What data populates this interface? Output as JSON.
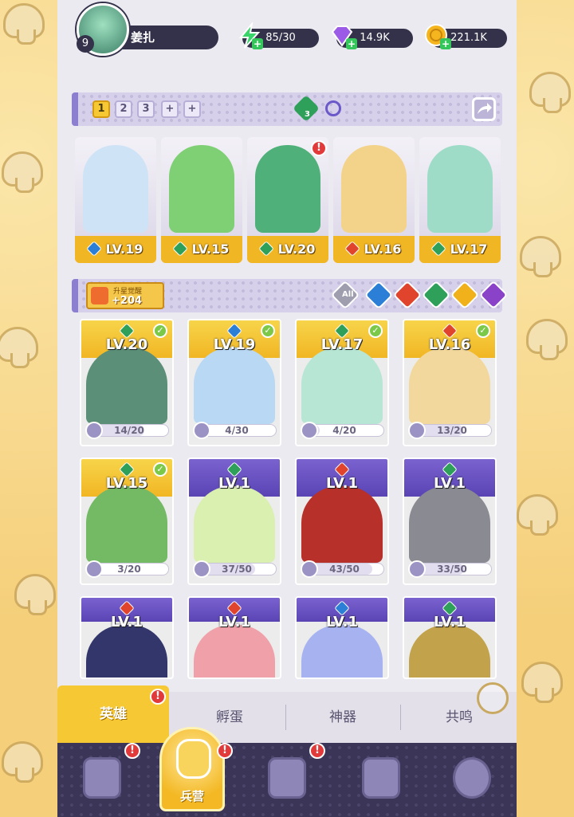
{
  "player": {
    "level": "9",
    "name": "姜扎"
  },
  "resources": {
    "energy": "85/30",
    "gems": "14.9K",
    "gold": "221.1K"
  },
  "team_bar": {
    "slots": [
      "1",
      "2",
      "3",
      "+",
      "+"
    ],
    "active_slot": "1",
    "gem_badge_count": "3"
  },
  "team": [
    {
      "level": "LV.19",
      "element": "water",
      "color": "#2b7fd6",
      "art": "#cfe3f7",
      "alert": false
    },
    {
      "level": "LV.15",
      "element": "nature",
      "color": "#2fa05a",
      "art": "#7fcf74",
      "alert": false
    },
    {
      "level": "LV.20",
      "element": "nature",
      "color": "#2fa05a",
      "art": "#4fb07a",
      "alert": true
    },
    {
      "level": "LV.16",
      "element": "fire",
      "color": "#e0442c",
      "art": "#f3d28a",
      "alert": false
    },
    {
      "level": "LV.17",
      "element": "nature",
      "color": "#2fa05a",
      "art": "#9fdcc8",
      "alert": false
    }
  ],
  "alert_mark": "!",
  "upgrade": {
    "label": "升星觉醒",
    "value": "+204"
  },
  "filters": {
    "all_label": "All",
    "elements": [
      {
        "name": "water",
        "color": "#2b7fd6"
      },
      {
        "name": "fire",
        "color": "#e0442c"
      },
      {
        "name": "nature",
        "color": "#2fa05a"
      },
      {
        "name": "light",
        "color": "#f0b11a"
      },
      {
        "name": "dark",
        "color": "#8a43c8"
      }
    ]
  },
  "heroes": [
    {
      "level": "LV.20",
      "element_color": "#2fa05a",
      "frame": "gold",
      "art": "#5b8f78",
      "shards": "14/20",
      "progress": 0.7,
      "check": true
    },
    {
      "level": "LV.19",
      "element_color": "#2b7fd6",
      "frame": "gold",
      "art": "#b9d8f4",
      "shards": "4/30",
      "progress": 0.13,
      "check": true
    },
    {
      "level": "LV.17",
      "element_color": "#2fa05a",
      "frame": "gold",
      "art": "#b8e6d4",
      "shards": "4/20",
      "progress": 0.2,
      "check": true
    },
    {
      "level": "LV.16",
      "element_color": "#e0442c",
      "frame": "gold",
      "art": "#f2d89c",
      "shards": "13/20",
      "progress": 0.65,
      "check": true
    },
    {
      "level": "LV.15",
      "element_color": "#2fa05a",
      "frame": "gold",
      "art": "#74b964",
      "shards": "3/20",
      "progress": 0.15,
      "check": true
    },
    {
      "level": "LV.1",
      "element_color": "#2fa05a",
      "frame": "purple",
      "art": "#d9f0b0",
      "shards": "37/50",
      "progress": 0.74,
      "check": false
    },
    {
      "level": "LV.1",
      "element_color": "#e0442c",
      "frame": "purple",
      "art": "#b8302a",
      "shards": "43/50",
      "progress": 0.86,
      "check": false
    },
    {
      "level": "LV.1",
      "element_color": "#2fa05a",
      "frame": "purple",
      "art": "#8a8a92",
      "shards": "33/50",
      "progress": 0.66,
      "check": false
    },
    {
      "level": "LV.1",
      "element_color": "#e0442c",
      "frame": "purple",
      "art": "#33366a",
      "shards": "",
      "progress": 0,
      "check": false
    },
    {
      "level": "LV.1",
      "element_color": "#e0442c",
      "frame": "purple",
      "art": "#f0a0a8",
      "shards": "",
      "progress": 0,
      "check": false
    },
    {
      "level": "LV.1",
      "element_color": "#2b7fd6",
      "frame": "purple",
      "art": "#a7b3f0",
      "shards": "",
      "progress": 0,
      "check": false
    },
    {
      "level": "LV.1",
      "element_color": "#2fa05a",
      "frame": "purple",
      "art": "#c2a24a",
      "shards": "",
      "progress": 0,
      "check": false
    }
  ],
  "tabs": [
    "英雄",
    "孵蛋",
    "神器",
    "共鸣"
  ],
  "nav": {
    "active_label": "兵营"
  },
  "colors": {
    "accent_gold": "#f6c834",
    "panel_dark": "#34324a",
    "nav_bg": "#3b3557"
  }
}
